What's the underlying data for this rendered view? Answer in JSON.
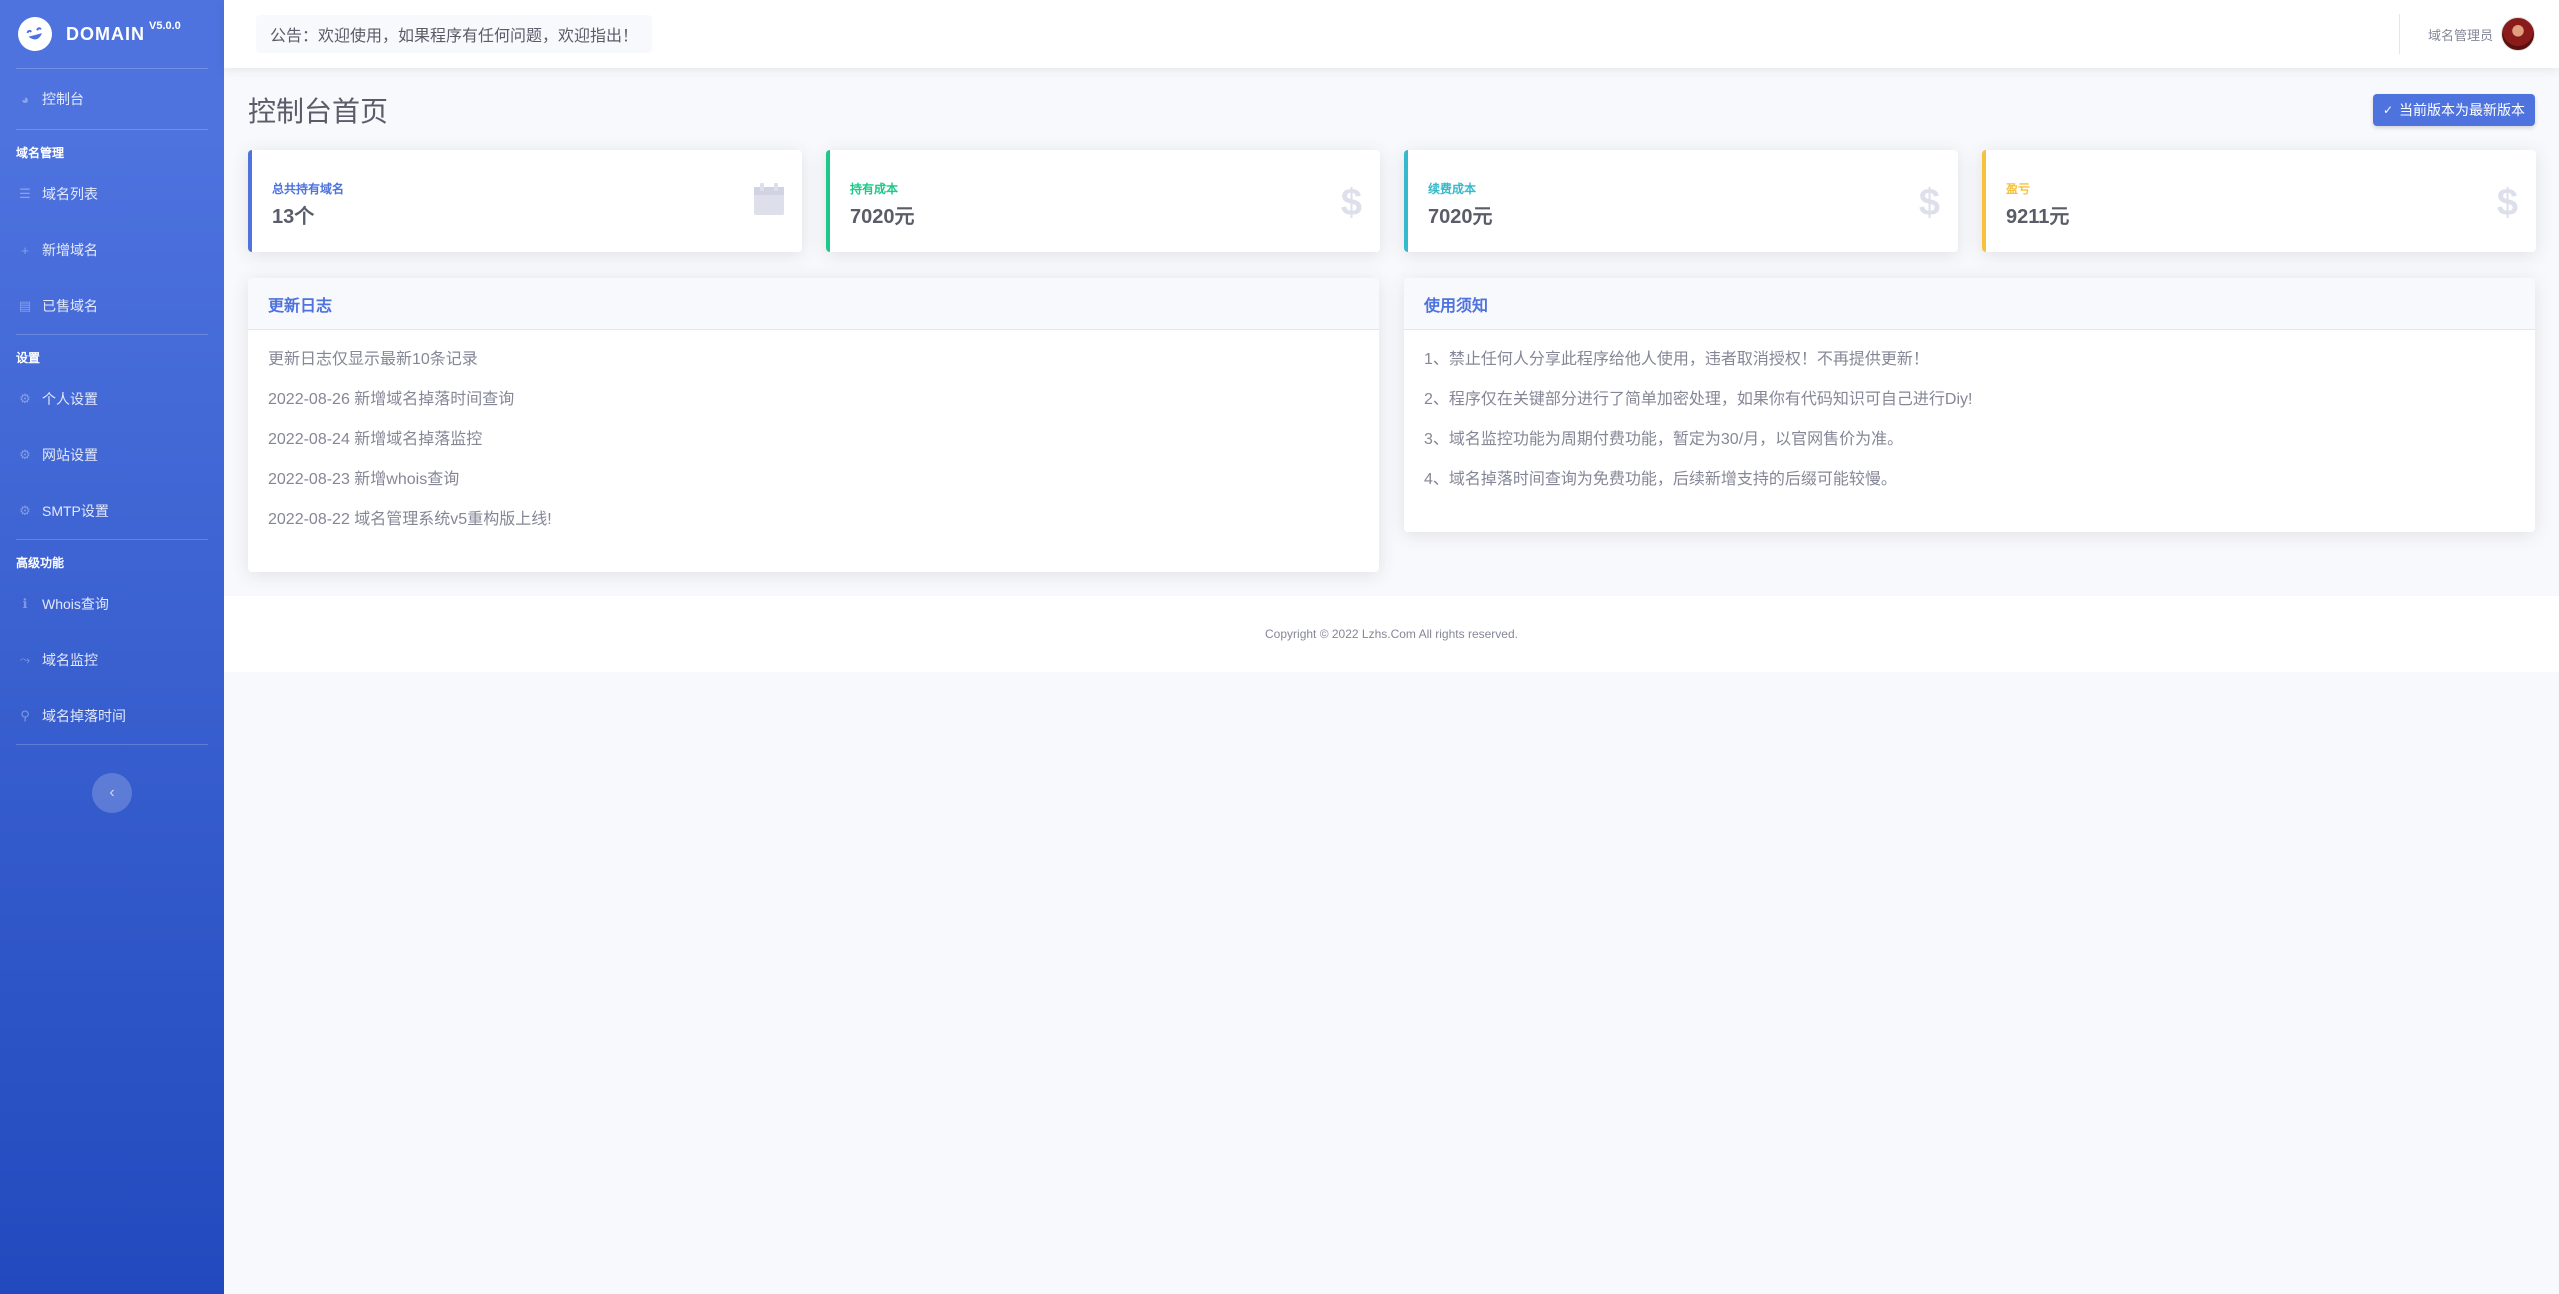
{
  "brand": {
    "name": "DOMAIN",
    "version": "V5.0.0"
  },
  "sidebar": {
    "dashboard": "控制台",
    "sections": [
      {
        "heading": "域名管理",
        "items": [
          {
            "label": "域名列表",
            "icon": "list-icon"
          },
          {
            "label": "新增域名",
            "icon": "plus-icon"
          },
          {
            "label": "已售域名",
            "icon": "card-icon"
          }
        ]
      },
      {
        "heading": "设置",
        "items": [
          {
            "label": "个人设置",
            "icon": "gear-icon"
          },
          {
            "label": "网站设置",
            "icon": "gear-icon"
          },
          {
            "label": "SMTP设置",
            "icon": "gear-icon"
          }
        ]
      },
      {
        "heading": "高级功能",
        "items": [
          {
            "label": "Whois查询",
            "icon": "info-icon"
          },
          {
            "label": "域名监控",
            "icon": "bolt-icon"
          },
          {
            "label": "域名掉落时间",
            "icon": "search-icon"
          }
        ]
      }
    ]
  },
  "topbar": {
    "notice": "公告：欢迎使用，如果程序有任何问题，欢迎指出！",
    "user_name": "域名管理员"
  },
  "page": {
    "title": "控制台首页",
    "version_button": "当前版本为最新版本"
  },
  "stats": [
    {
      "label": "总共持有域名",
      "value": "13个",
      "color": "#4e73df",
      "icon": "calendar-icon"
    },
    {
      "label": "持有成本",
      "value": "7020元",
      "color": "#1cc88a",
      "icon": "dollar-icon"
    },
    {
      "label": "续费成本",
      "value": "7020元",
      "color": "#36b9cc",
      "icon": "dollar-icon"
    },
    {
      "label": "盈亏",
      "value": "9211元",
      "color": "#f6c23e",
      "icon": "dollar-icon"
    }
  ],
  "changelog": {
    "title": "更新日志",
    "lines": [
      "更新日志仅显示最新10条记录",
      "2022-08-26 新增域名掉落时间查询",
      "2022-08-24 新增域名掉落监控",
      "2022-08-23 新增whois查询",
      "2022-08-22 域名管理系统v5重构版上线!"
    ]
  },
  "notes": {
    "title": "使用须知",
    "lines": [
      "1、禁止任何人分享此程序给他人使用，违者取消授权！不再提供更新！",
      "2、程序仅在关键部分进行了简单加密处理，如果你有代码知识可自己进行Diy!",
      "3、域名监控功能为周期付费功能，暂定为30/月，以官网售价为准。",
      "4、域名掉落时间查询为免费功能，后续新增支持的后缀可能较慢。"
    ]
  },
  "footer": {
    "copyright": "Copyright © 2022 Lzhs.Com All rights reserved."
  }
}
